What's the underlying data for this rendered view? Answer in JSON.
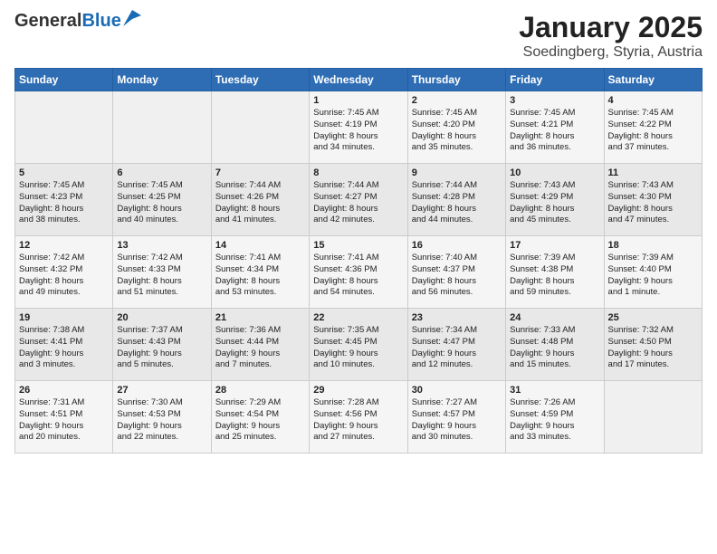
{
  "header": {
    "logo_general": "General",
    "logo_blue": "Blue",
    "title": "January 2025",
    "subtitle": "Soedingberg, Styria, Austria"
  },
  "days_of_week": [
    "Sunday",
    "Monday",
    "Tuesday",
    "Wednesday",
    "Thursday",
    "Friday",
    "Saturday"
  ],
  "weeks": [
    [
      {
        "day": "",
        "content": ""
      },
      {
        "day": "",
        "content": ""
      },
      {
        "day": "",
        "content": ""
      },
      {
        "day": "1",
        "content": "Sunrise: 7:45 AM\nSunset: 4:19 PM\nDaylight: 8 hours\nand 34 minutes."
      },
      {
        "day": "2",
        "content": "Sunrise: 7:45 AM\nSunset: 4:20 PM\nDaylight: 8 hours\nand 35 minutes."
      },
      {
        "day": "3",
        "content": "Sunrise: 7:45 AM\nSunset: 4:21 PM\nDaylight: 8 hours\nand 36 minutes."
      },
      {
        "day": "4",
        "content": "Sunrise: 7:45 AM\nSunset: 4:22 PM\nDaylight: 8 hours\nand 37 minutes."
      }
    ],
    [
      {
        "day": "5",
        "content": "Sunrise: 7:45 AM\nSunset: 4:23 PM\nDaylight: 8 hours\nand 38 minutes."
      },
      {
        "day": "6",
        "content": "Sunrise: 7:45 AM\nSunset: 4:25 PM\nDaylight: 8 hours\nand 40 minutes."
      },
      {
        "day": "7",
        "content": "Sunrise: 7:44 AM\nSunset: 4:26 PM\nDaylight: 8 hours\nand 41 minutes."
      },
      {
        "day": "8",
        "content": "Sunrise: 7:44 AM\nSunset: 4:27 PM\nDaylight: 8 hours\nand 42 minutes."
      },
      {
        "day": "9",
        "content": "Sunrise: 7:44 AM\nSunset: 4:28 PM\nDaylight: 8 hours\nand 44 minutes."
      },
      {
        "day": "10",
        "content": "Sunrise: 7:43 AM\nSunset: 4:29 PM\nDaylight: 8 hours\nand 45 minutes."
      },
      {
        "day": "11",
        "content": "Sunrise: 7:43 AM\nSunset: 4:30 PM\nDaylight: 8 hours\nand 47 minutes."
      }
    ],
    [
      {
        "day": "12",
        "content": "Sunrise: 7:42 AM\nSunset: 4:32 PM\nDaylight: 8 hours\nand 49 minutes."
      },
      {
        "day": "13",
        "content": "Sunrise: 7:42 AM\nSunset: 4:33 PM\nDaylight: 8 hours\nand 51 minutes."
      },
      {
        "day": "14",
        "content": "Sunrise: 7:41 AM\nSunset: 4:34 PM\nDaylight: 8 hours\nand 53 minutes."
      },
      {
        "day": "15",
        "content": "Sunrise: 7:41 AM\nSunset: 4:36 PM\nDaylight: 8 hours\nand 54 minutes."
      },
      {
        "day": "16",
        "content": "Sunrise: 7:40 AM\nSunset: 4:37 PM\nDaylight: 8 hours\nand 56 minutes."
      },
      {
        "day": "17",
        "content": "Sunrise: 7:39 AM\nSunset: 4:38 PM\nDaylight: 8 hours\nand 59 minutes."
      },
      {
        "day": "18",
        "content": "Sunrise: 7:39 AM\nSunset: 4:40 PM\nDaylight: 9 hours\nand 1 minute."
      }
    ],
    [
      {
        "day": "19",
        "content": "Sunrise: 7:38 AM\nSunset: 4:41 PM\nDaylight: 9 hours\nand 3 minutes."
      },
      {
        "day": "20",
        "content": "Sunrise: 7:37 AM\nSunset: 4:43 PM\nDaylight: 9 hours\nand 5 minutes."
      },
      {
        "day": "21",
        "content": "Sunrise: 7:36 AM\nSunset: 4:44 PM\nDaylight: 9 hours\nand 7 minutes."
      },
      {
        "day": "22",
        "content": "Sunrise: 7:35 AM\nSunset: 4:45 PM\nDaylight: 9 hours\nand 10 minutes."
      },
      {
        "day": "23",
        "content": "Sunrise: 7:34 AM\nSunset: 4:47 PM\nDaylight: 9 hours\nand 12 minutes."
      },
      {
        "day": "24",
        "content": "Sunrise: 7:33 AM\nSunset: 4:48 PM\nDaylight: 9 hours\nand 15 minutes."
      },
      {
        "day": "25",
        "content": "Sunrise: 7:32 AM\nSunset: 4:50 PM\nDaylight: 9 hours\nand 17 minutes."
      }
    ],
    [
      {
        "day": "26",
        "content": "Sunrise: 7:31 AM\nSunset: 4:51 PM\nDaylight: 9 hours\nand 20 minutes."
      },
      {
        "day": "27",
        "content": "Sunrise: 7:30 AM\nSunset: 4:53 PM\nDaylight: 9 hours\nand 22 minutes."
      },
      {
        "day": "28",
        "content": "Sunrise: 7:29 AM\nSunset: 4:54 PM\nDaylight: 9 hours\nand 25 minutes."
      },
      {
        "day": "29",
        "content": "Sunrise: 7:28 AM\nSunset: 4:56 PM\nDaylight: 9 hours\nand 27 minutes."
      },
      {
        "day": "30",
        "content": "Sunrise: 7:27 AM\nSunset: 4:57 PM\nDaylight: 9 hours\nand 30 minutes."
      },
      {
        "day": "31",
        "content": "Sunrise: 7:26 AM\nSunset: 4:59 PM\nDaylight: 9 hours\nand 33 minutes."
      },
      {
        "day": "",
        "content": ""
      }
    ]
  ]
}
